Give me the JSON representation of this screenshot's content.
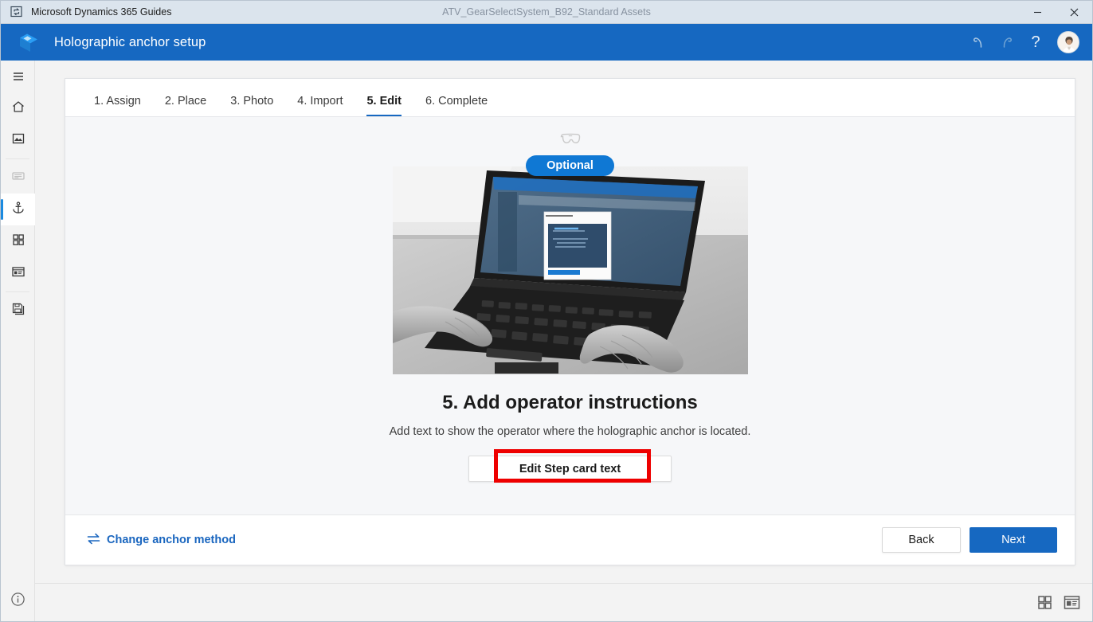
{
  "titlebar": {
    "app_icon": "dynamics-guides-app-icon",
    "app_name": "Microsoft Dynamics 365 Guides",
    "document_name": "ATV_GearSelectSystem_B92_Standard Assets",
    "minimize_label": "–",
    "close_label": "✕"
  },
  "header": {
    "logo_icon": "guides-logo-icon",
    "title": "Holographic anchor setup",
    "undo_icon": "undo-icon",
    "redo_icon": "redo-icon",
    "help_icon": "help-icon",
    "help_label": "?",
    "avatar_icon": "user-avatar"
  },
  "rail": {
    "items": [
      {
        "icon": "hamburger-menu-icon",
        "name": "menu",
        "state": "normal"
      },
      {
        "icon": "home-icon",
        "name": "home",
        "state": "normal"
      },
      {
        "icon": "media-image-icon",
        "name": "media",
        "state": "normal"
      },
      {
        "icon": "text-lines-icon",
        "name": "steps",
        "state": "dim"
      },
      {
        "icon": "anchor-icon",
        "name": "anchor",
        "state": "active"
      },
      {
        "icon": "grid-tiles-icon",
        "name": "tiles",
        "state": "normal"
      },
      {
        "icon": "card-window-icon",
        "name": "cards",
        "state": "normal"
      },
      {
        "icon": "save-copies-icon",
        "name": "save",
        "state": "normal"
      }
    ],
    "info_icon": "info-icon"
  },
  "tabs": [
    {
      "label": "1. Assign",
      "active": false
    },
    {
      "label": "2. Place",
      "active": false
    },
    {
      "label": "3. Photo",
      "active": false
    },
    {
      "label": "4. Import",
      "active": false
    },
    {
      "label": "5. Edit",
      "active": true
    },
    {
      "label": "6. Complete",
      "active": false
    }
  ],
  "content": {
    "headset_icon": "hololens-headset-icon",
    "badge": "Optional",
    "photo_alt": "hands-typing-on-laptop-photo",
    "heading": "5. Add operator instructions",
    "description": "Add text to show the operator where the holographic anchor is located.",
    "primary_action": "Edit Step card text",
    "highlight_color": "#ee0000"
  },
  "footer": {
    "change_method_icon": "swap-arrows-icon",
    "change_method_label": "Change anchor method",
    "back_label": "Back",
    "next_label": "Next"
  },
  "statusbar": {
    "grid_view_icon": "grid-view-icon",
    "detail_view_icon": "detail-view-icon"
  },
  "colors": {
    "brand_blue": "#1668c1",
    "badge_blue": "#0f78d4",
    "accent_link": "#1a66bf",
    "titlebar_bg": "#dbe4ed",
    "highlight_red": "#ee0000"
  }
}
